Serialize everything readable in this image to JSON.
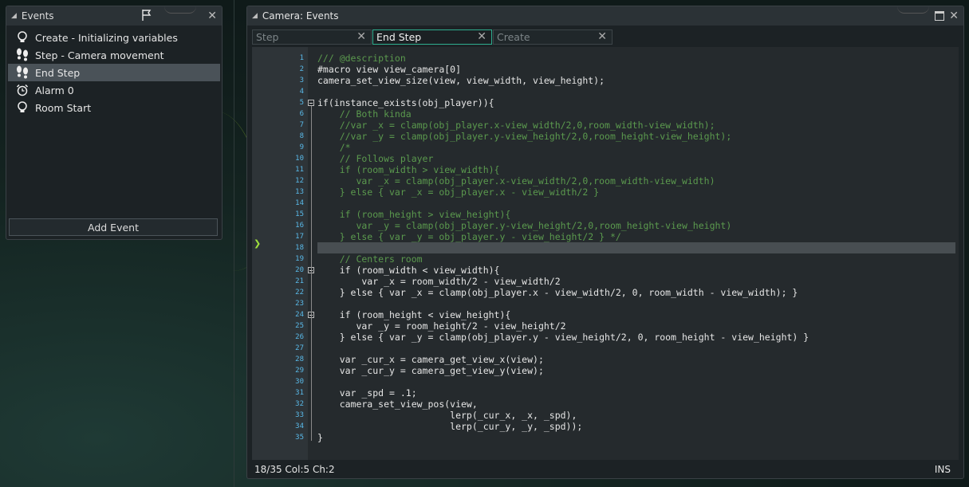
{
  "events_panel": {
    "title": "Events",
    "items": [
      {
        "label": "Create - Initializing variables",
        "icon": "lightbulb-icon"
      },
      {
        "label": "Step - Camera movement",
        "icon": "footsteps-icon"
      },
      {
        "label": "End Step",
        "icon": "footsteps-icon",
        "selected": true
      },
      {
        "label": "Alarm 0",
        "icon": "alarm-clock-icon"
      },
      {
        "label": "Room Start",
        "icon": "lightbulb-icon"
      }
    ],
    "add_event_label": "Add Event"
  },
  "code_window": {
    "title": "Camera: Events",
    "tabs": [
      {
        "label": "Step",
        "active": false
      },
      {
        "label": "End Step",
        "active": true
      },
      {
        "label": "Create",
        "active": false
      }
    ],
    "status": {
      "position": "18/35 Col:5 Ch:2",
      "mode": "INS"
    },
    "current_line": 18,
    "lines": [
      "/// @description",
      "#macro view view_camera[0]",
      "camera_set_view_size(view, view_width, view_height);",
      "",
      "if(instance_exists(obj_player)){",
      "    // Both kinda",
      "    //var _x = clamp(obj_player.x-view_width/2,0,room_width-view_width);",
      "    //var _y = clamp(obj_player.y-view_height/2,0,room_height-view_height);",
      "    /*",
      "    // Follows player",
      "    if (room_width > view_width){",
      "       var _x = clamp(obj_player.x-view_width/2,0,room_width-view_width)",
      "    } else { var _x = obj_player.x - view_width/2 }",
      "",
      "    if (room_height > view_height){",
      "       var _y = clamp(obj_player.y-view_height/2,0,room_height-view_height)",
      "    } else { var _y = obj_player.y - view_height/2 } */",
      "",
      "    // Centers room",
      "    if (room_width < view_width){",
      "        var _x = room_width/2 - view_width/2",
      "    } else { var _x = clamp(obj_player.x - view_width/2, 0, room_width - view_width); }",
      "",
      "    if (room_height < view_height){",
      "       var _y = room_height/2 - view_height/2",
      "    } else { var _y = clamp(obj_player.y - view_height/2, 0, room_height - view_height) }",
      "",
      "    var _cur_x = camera_get_view_x(view);",
      "    var _cur_y = camera_get_view_y(view);",
      "",
      "    var _spd = .1;",
      "    camera_set_view_pos(view,",
      "                        lerp(_cur_x, _x, _spd),",
      "                        lerp(_cur_y, _y, _spd));",
      "}"
    ]
  }
}
